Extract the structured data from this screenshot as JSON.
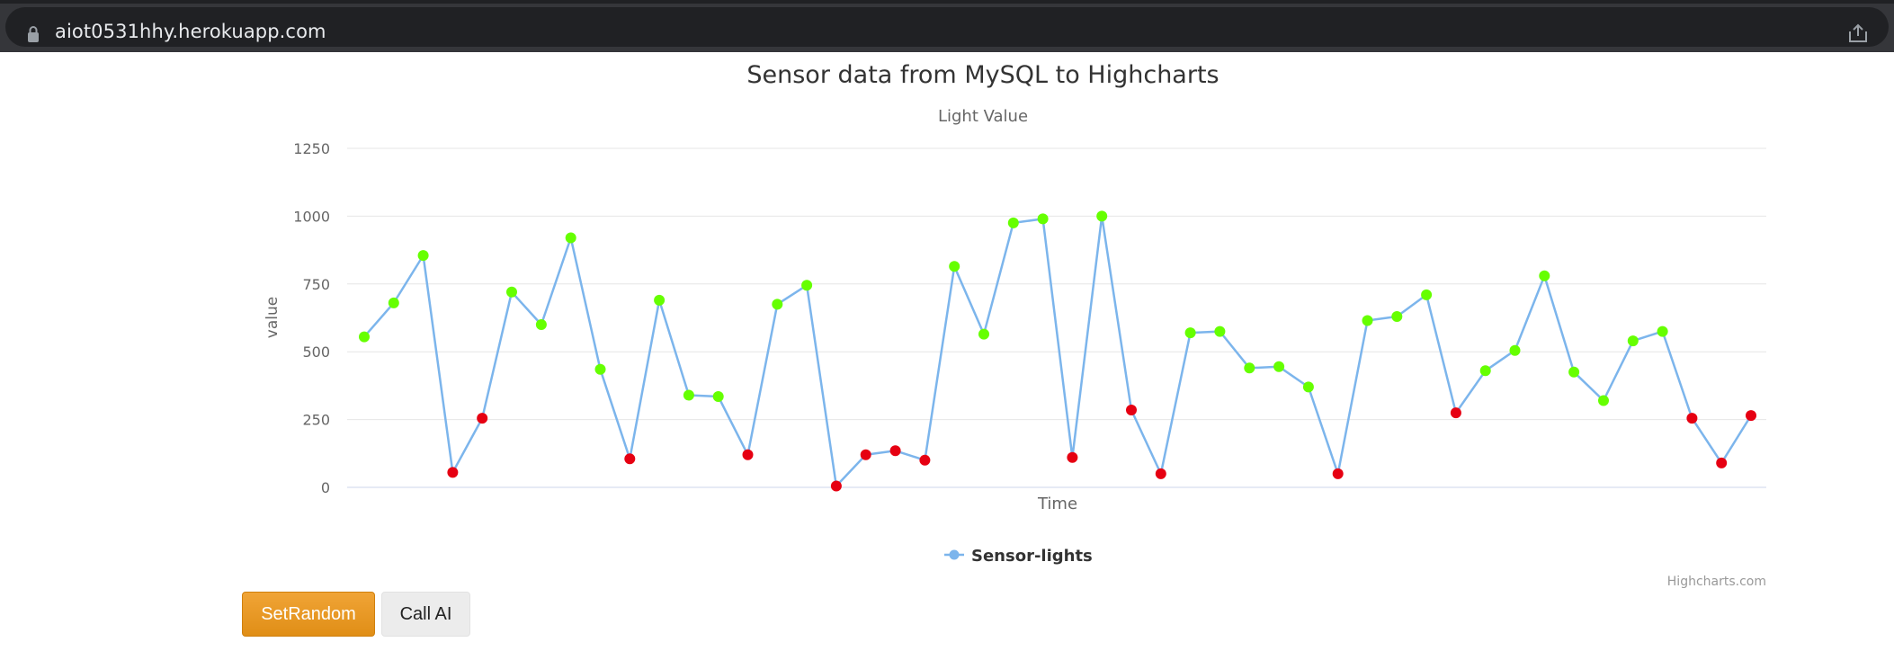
{
  "browser": {
    "url": "aiot0531hhy.herokuapp.com"
  },
  "chart_data": {
    "type": "line",
    "title": "Sensor data from MySQL to Highcharts",
    "subtitle": "Light Value",
    "xlabel": "Time",
    "ylabel": "value",
    "ylim": [
      0,
      1250
    ],
    "yticks": [
      0,
      250,
      500,
      750,
      1000,
      1250
    ],
    "grid": true,
    "legend": "bottom-center",
    "credits": "Highcharts.com",
    "series": [
      {
        "name": "Sensor-lights",
        "color": "#7cb5ec",
        "values": [
          555,
          680,
          855,
          55,
          255,
          720,
          600,
          920,
          435,
          105,
          690,
          340,
          335,
          120,
          675,
          745,
          5,
          120,
          135,
          100,
          815,
          565,
          975,
          990,
          110,
          1000,
          285,
          50,
          570,
          575,
          440,
          445,
          370,
          50,
          615,
          630,
          710,
          275,
          430,
          505,
          780,
          425,
          320,
          540,
          575,
          255,
          90,
          265
        ]
      }
    ],
    "marker_colors": {
      "high": "#66ff00",
      "low": "#e60012"
    },
    "threshold": 300
  },
  "buttons": {
    "set_random": "SetRandom",
    "call_ai": "Call AI"
  },
  "icons": {
    "lock": "lock-icon",
    "share": "share-icon"
  }
}
